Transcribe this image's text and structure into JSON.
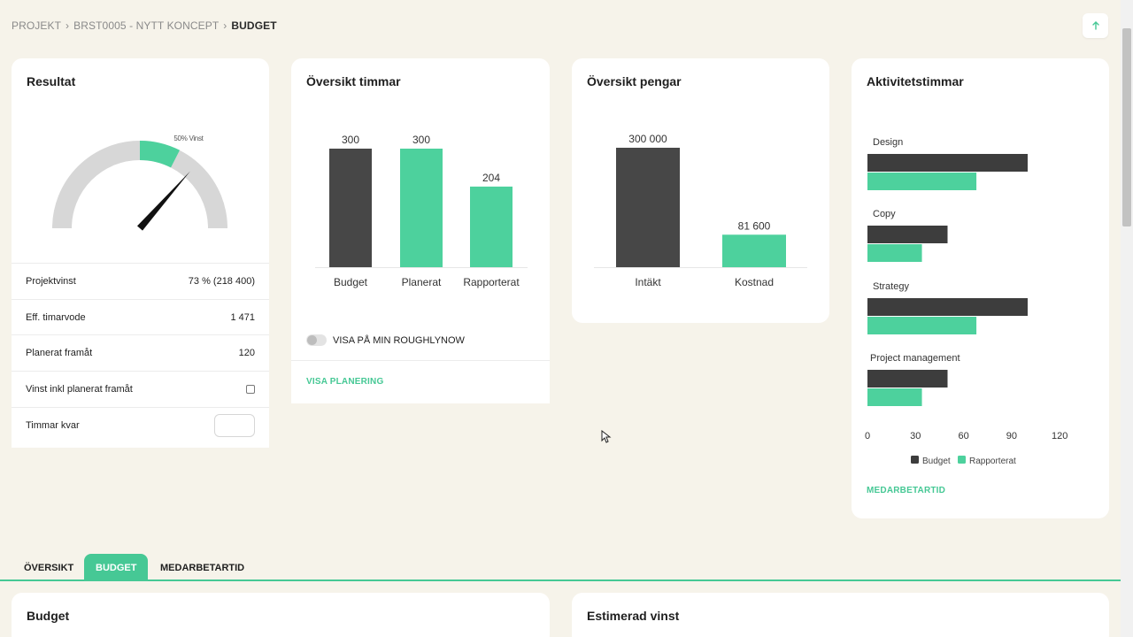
{
  "breadcrumb": {
    "items": [
      "PROJEKT",
      "BRST0005 - NYTT KONCEPT",
      "BUDGET"
    ],
    "separator": "›"
  },
  "top_button_icon": "arrow-up-icon",
  "result": {
    "title": "Resultat",
    "gauge_label": "50% Vinst",
    "gauge_green_range_percent": [
      50,
      65
    ],
    "gauge_needle_percent": 73,
    "rows": [
      {
        "label": "Projektvinst",
        "value": "73 % (218 400)"
      },
      {
        "label": "Eff. timarvode",
        "value": "1 471"
      },
      {
        "label": "Planerat framåt",
        "value": "120"
      },
      {
        "label": "Vinst inkl planerat framåt",
        "value": ""
      },
      {
        "label": "Timmar kvar",
        "value": ""
      }
    ]
  },
  "hours": {
    "title": "Översikt timmar",
    "toggle_label": "VISA PÅ MIN ROUGHLYNOW",
    "link": "VISA PLANERING"
  },
  "money": {
    "title": "Översikt pengar"
  },
  "activity": {
    "title": "Aktivitetstimmar",
    "link": "MEDARBETARTID"
  },
  "tabs": {
    "items": [
      "ÖVERSIKT",
      "BUDGET",
      "MEDARBETARTID"
    ],
    "active": "BUDGET"
  },
  "bottom": {
    "budget_title": "Budget",
    "estimate_title": "Estimerad vinst"
  },
  "colors": {
    "dark": "#474747",
    "green": "#4dd19d",
    "gauge_gray": "#d7d7d7",
    "link_green": "#46c895",
    "background": "#f6f3ea"
  },
  "chart_data": [
    {
      "type": "bar",
      "title": "Översikt timmar",
      "categories": [
        "Budget",
        "Planerat",
        "Rapporterat"
      ],
      "values": [
        300,
        300,
        204
      ],
      "labels": [
        "300",
        "300",
        "204"
      ],
      "colors": [
        "#474747",
        "#4dd19d",
        "#4dd19d"
      ],
      "ylim": [
        0,
        300
      ]
    },
    {
      "type": "bar",
      "title": "Översikt pengar",
      "categories": [
        "Intäkt",
        "Kostnad"
      ],
      "values": [
        300000,
        81600
      ],
      "labels": [
        "300 000",
        "81 600"
      ],
      "colors": [
        "#474747",
        "#4dd19d"
      ],
      "ylim": [
        0,
        300000
      ]
    },
    {
      "type": "bar",
      "orientation": "horizontal",
      "title": "Aktivitetstimmar",
      "categories": [
        "Design",
        "Copy",
        "Strategy",
        "Project management"
      ],
      "series": [
        {
          "name": "Budget",
          "values": [
            100,
            50,
            100,
            50
          ],
          "color": "#3d3d3d"
        },
        {
          "name": "Rapporterat",
          "values": [
            68,
            34,
            68,
            34
          ],
          "color": "#4dd19d"
        }
      ],
      "xticks": [
        "0",
        "30",
        "60",
        "90",
        "120"
      ],
      "xlim": [
        0,
        120
      ],
      "legend": "bottom"
    }
  ]
}
